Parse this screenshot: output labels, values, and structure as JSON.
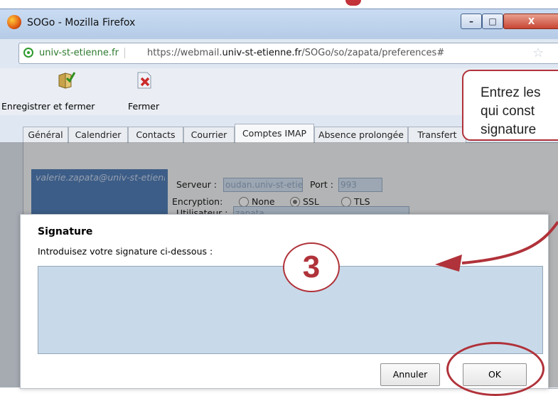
{
  "window": {
    "title": "SOGo - Mozilla Firefox",
    "min_glyph": "–",
    "max_glyph": "□",
    "close_glyph": "X"
  },
  "urlbar": {
    "identity": "univ-st-etienne.fr",
    "url_prefix": "https://webmail.",
    "url_domain": "univ-st-etienne.fr",
    "url_path": "/SOGo/so/zapata/preferences#"
  },
  "toolbar": {
    "save_label": "Enregistrer et fermer",
    "close_label": "Fermer"
  },
  "tabs": [
    {
      "label": "Général"
    },
    {
      "label": "Calendrier"
    },
    {
      "label": "Contacts"
    },
    {
      "label": "Courrier"
    },
    {
      "label": "Comptes IMAP"
    },
    {
      "label": "Absence prolongée"
    },
    {
      "label": "Transfert"
    }
  ],
  "imap": {
    "account": "valerie.zapata@univ-st-etienne.fr",
    "server_label": "Serveur :",
    "server_value": "oudan.univ-st-etienne.fr",
    "port_label": "Port :",
    "port_value": "993",
    "encryption_label": "Encryption:",
    "enc_options": [
      "None",
      "SSL",
      "TLS"
    ],
    "user_label": "Utilisateur :",
    "user_value": "zapata"
  },
  "dialog": {
    "title": "Signature",
    "prompt": "Introduisez votre signature ci-dessous :",
    "signature_value": "",
    "cancel_label": "Annuler",
    "ok_label": "OK"
  },
  "annotation": {
    "callout_text": "Entrez les\nqui const\nsignature",
    "step_number": "3",
    "accent_color": "#b0323a"
  }
}
